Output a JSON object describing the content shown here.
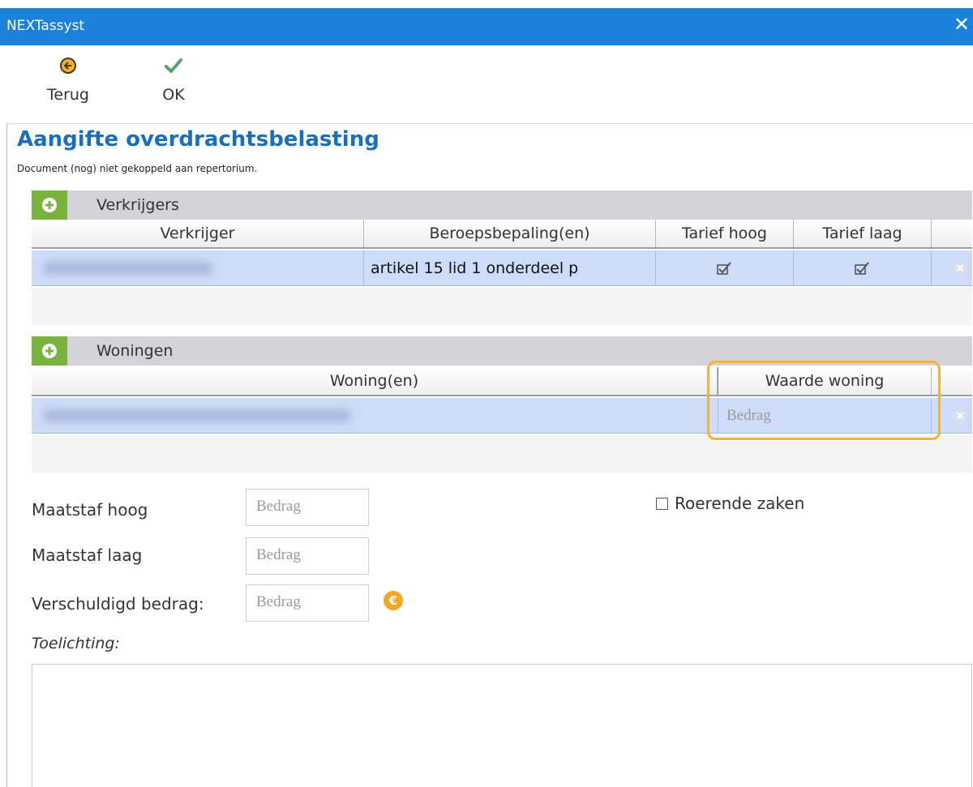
{
  "window": {
    "title": "NEXTassyst",
    "close_glyph": "✕"
  },
  "toolbar": {
    "back_label": "Terug",
    "ok_label": "OK",
    "back_icon": "arrow-left-circle-icon",
    "ok_icon": "checkmark-icon"
  },
  "page": {
    "title": "Aangifte overdrachtsbelasting",
    "subtitle": "Document (nog) niet gekoppeld aan repertorium."
  },
  "verkrijgers": {
    "section_label": "Verkrijgers",
    "columns": [
      "Verkrijger",
      "Beroepsbepaling(en)",
      "Tarief hoog",
      "Tarief laag"
    ],
    "rows": [
      {
        "beroepsbepaling": "artikel 15 lid 1 onderdeel p",
        "tarief_hoog": true,
        "tarief_laag": true
      }
    ]
  },
  "woningen": {
    "section_label": "Woningen",
    "columns": [
      "Woning(en)",
      "Waarde woning"
    ],
    "rows": [
      {
        "waarde_placeholder": "Bedrag"
      }
    ]
  },
  "form": {
    "maatstaf_hoog_label": "Maatstaf hoog",
    "maatstaf_laag_label": "Maatstaf laag",
    "verschuldigd_label": "Verschuldigd bedrag:",
    "amount_placeholder": "Bedrag",
    "euro_symbol": "€",
    "roerende_zaken_label": "Roerende zaken",
    "roerende_zaken_checked": false,
    "toelichting_label": "Toelichting:"
  },
  "colors": {
    "titlebar": "#1c82d9",
    "title_text": "#1a6fbd",
    "add_button": "#7ab33c",
    "row_selected": "#cfdcf9",
    "highlight": "#f0b43a",
    "euro_icon": "#f2a623"
  }
}
